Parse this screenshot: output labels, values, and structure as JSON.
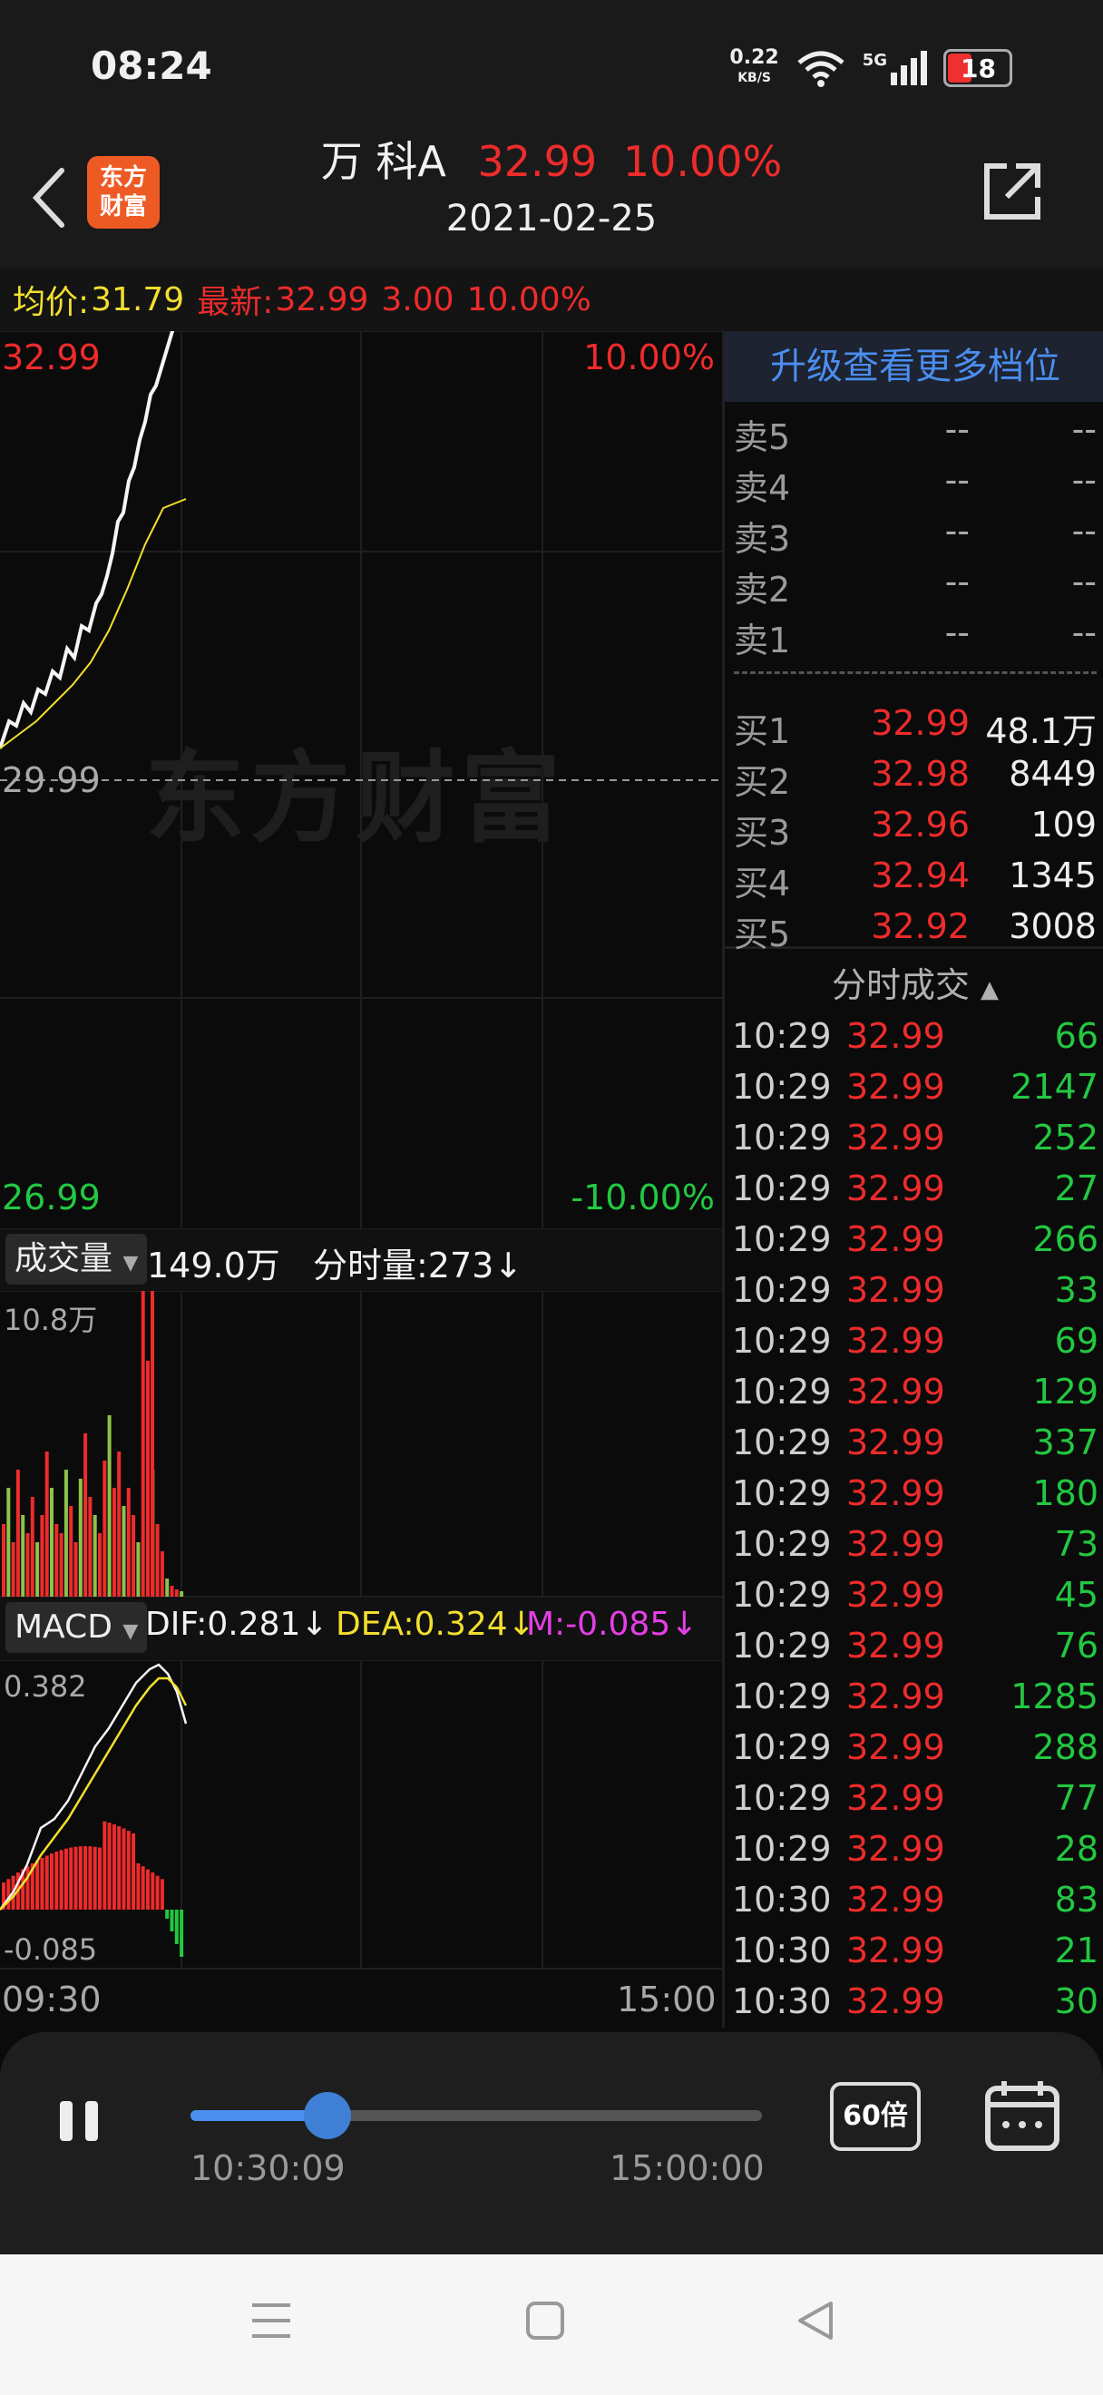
{
  "status_bar": {
    "time": "08:24",
    "net_speed": "0.22",
    "net_unit": "KB/S",
    "network": "5G",
    "battery": "18",
    "icons": [
      "wifi-icon",
      "signal-icon",
      "battery-icon"
    ]
  },
  "header": {
    "stock_name": "万 科A",
    "price": "32.99",
    "change_pct": "10.00%",
    "date": "2021-02-25",
    "logo_line1": "东方",
    "logo_line2": "财富"
  },
  "info_bar": {
    "avg_label": "均价:",
    "avg_value": "31.79",
    "latest_label": "最新:",
    "latest_value": "32.99",
    "change": "3.00",
    "change_pct": "10.00%"
  },
  "price_chart": {
    "watermark": "东方财富",
    "top_price": "32.99",
    "top_pct": "10.00%",
    "mid_price": "29.99",
    "bottom_price": "26.99",
    "bottom_pct": "-10.00%"
  },
  "volume_panel": {
    "indicator_label": "成交量",
    "total": "149.0万",
    "minute_label": "分时量:273↓",
    "max_label": "10.8万"
  },
  "macd_panel": {
    "indicator_label": "MACD",
    "dif": "DIF:0.281↓",
    "dea": "DEA:0.324↓",
    "m": "M:-0.085↓",
    "top_label": "0.382",
    "bottom_label": "-0.085"
  },
  "time_axis": {
    "start": "09:30",
    "end": "15:00"
  },
  "order_book": {
    "upgrade_text": "升级查看更多档位",
    "asks": [
      {
        "label": "卖5",
        "price": "--",
        "volume": "--"
      },
      {
        "label": "卖4",
        "price": "--",
        "volume": "--"
      },
      {
        "label": "卖3",
        "price": "--",
        "volume": "--"
      },
      {
        "label": "卖2",
        "price": "--",
        "volume": "--"
      },
      {
        "label": "卖1",
        "price": "--",
        "volume": "--"
      }
    ],
    "bids": [
      {
        "label": "买1",
        "price": "32.99",
        "volume": "48.1万"
      },
      {
        "label": "买2",
        "price": "32.98",
        "volume": "8449"
      },
      {
        "label": "买3",
        "price": "32.96",
        "volume": "109"
      },
      {
        "label": "买4",
        "price": "32.94",
        "volume": "1345"
      },
      {
        "label": "买5",
        "price": "32.92",
        "volume": "3008"
      }
    ]
  },
  "trades": {
    "header": "分时成交",
    "rows": [
      {
        "time": "10:29",
        "price": "32.99",
        "volume": "66"
      },
      {
        "time": "10:29",
        "price": "32.99",
        "volume": "2147"
      },
      {
        "time": "10:29",
        "price": "32.99",
        "volume": "252"
      },
      {
        "time": "10:29",
        "price": "32.99",
        "volume": "27"
      },
      {
        "time": "10:29",
        "price": "32.99",
        "volume": "266"
      },
      {
        "time": "10:29",
        "price": "32.99",
        "volume": "33"
      },
      {
        "time": "10:29",
        "price": "32.99",
        "volume": "69"
      },
      {
        "time": "10:29",
        "price": "32.99",
        "volume": "129"
      },
      {
        "time": "10:29",
        "price": "32.99",
        "volume": "337"
      },
      {
        "time": "10:29",
        "price": "32.99",
        "volume": "180"
      },
      {
        "time": "10:29",
        "price": "32.99",
        "volume": "73"
      },
      {
        "time": "10:29",
        "price": "32.99",
        "volume": "45"
      },
      {
        "time": "10:29",
        "price": "32.99",
        "volume": "76"
      },
      {
        "time": "10:29",
        "price": "32.99",
        "volume": "1285"
      },
      {
        "time": "10:29",
        "price": "32.99",
        "volume": "288"
      },
      {
        "time": "10:29",
        "price": "32.99",
        "volume": "77"
      },
      {
        "time": "10:29",
        "price": "32.99",
        "volume": "28"
      },
      {
        "time": "10:30",
        "price": "32.99",
        "volume": "83"
      },
      {
        "time": "10:30",
        "price": "32.99",
        "volume": "21"
      },
      {
        "time": "10:30",
        "price": "32.99",
        "volume": "30"
      }
    ]
  },
  "playback": {
    "current_time": "10:30:09",
    "end_time": "15:00:00",
    "progress": 0.24,
    "speed_label": "60倍"
  },
  "colors": {
    "up": "#ee2b2b",
    "down": "#23c841",
    "accent": "#4a8ef0",
    "avg_line": "#f2df2e"
  }
}
